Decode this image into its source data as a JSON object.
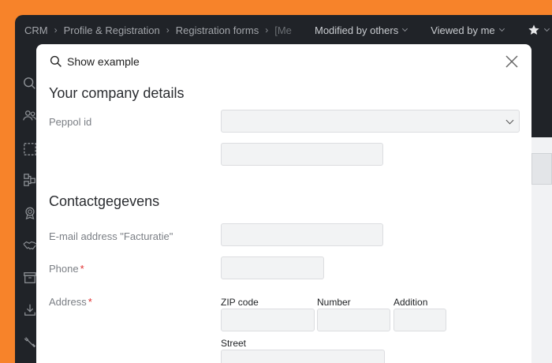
{
  "breadcrumb": {
    "items": [
      "CRM",
      "Profile & Registration",
      "Registration forms",
      "[Me"
    ],
    "separator": "›"
  },
  "filters": {
    "modified_by_others": "Modified by others",
    "viewed_by_me": "Viewed by me"
  },
  "sidebar": {
    "icons": [
      "search-icon",
      "users-icon",
      "dashed-square-icon",
      "workflow-icon",
      "badge-icon",
      "handshake-icon",
      "archive-icon",
      "download-icon",
      "tools-icon"
    ]
  },
  "modal": {
    "show_example_label": "Show example",
    "company_section": {
      "title": "Your company details",
      "peppol_label": "Peppol id",
      "peppol_value": "",
      "peppol_extra_value": ""
    },
    "contact_section": {
      "title": "Contactgegevens",
      "email_label": "E-mail address \"Facturatie\"",
      "email_value": "",
      "phone_label": "Phone",
      "phone_value": "",
      "address_label": "Address",
      "zip_label": "ZIP code",
      "number_label": "Number",
      "addition_label": "Addition",
      "street_label": "Street",
      "required_marker": "*"
    }
  },
  "colors": {
    "outer_background": "#f7832a",
    "app_background": "#202328",
    "input_background": "#f2f3f4",
    "required": "#e02d2d"
  }
}
